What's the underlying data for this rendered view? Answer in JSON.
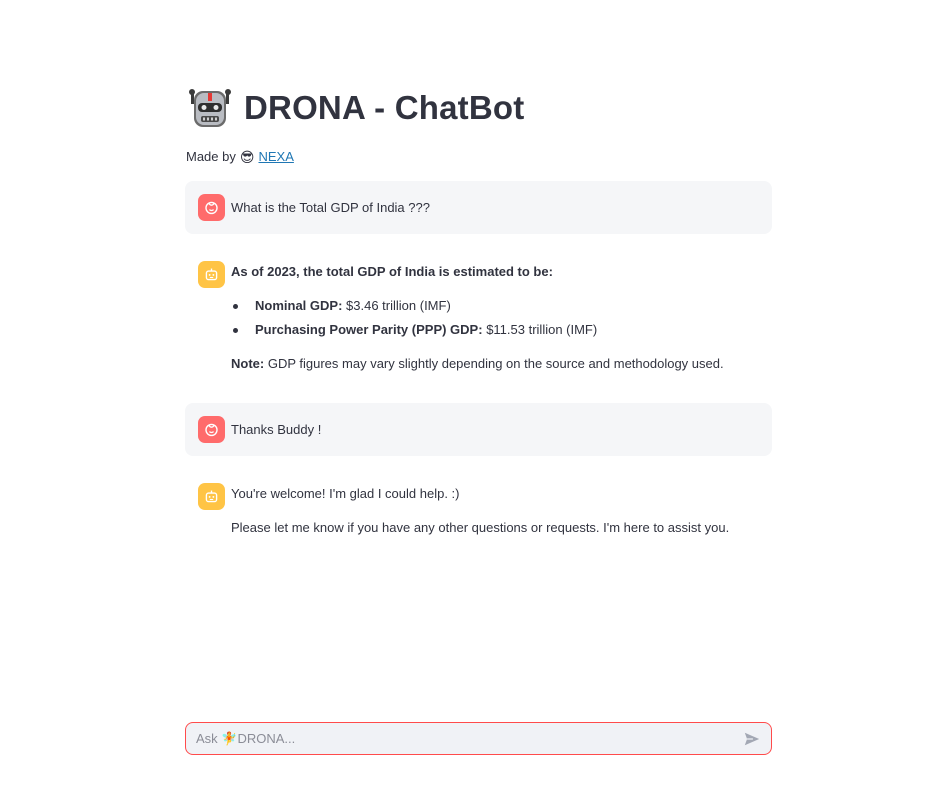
{
  "header": {
    "title": "DRONA - ChatBot",
    "made_by_prefix": "Made by",
    "made_by_emoji": "😎",
    "made_by_link": "NEXA"
  },
  "messages": [
    {
      "role": "user",
      "text": "What is the Total GDP of India ???"
    },
    {
      "role": "assistant",
      "intro": "As of 2023, the total GDP of India is estimated to be:",
      "bullets": [
        {
          "label": "Nominal GDP:",
          "value": "$3.46 trillion (IMF)"
        },
        {
          "label": "Purchasing Power Parity (PPP) GDP:",
          "value": "$11.53 trillion (IMF)"
        }
      ],
      "note_label": "Note:",
      "note_text": "GDP figures may vary slightly depending on the source and methodology used."
    },
    {
      "role": "user",
      "text": "Thanks Buddy !"
    },
    {
      "role": "assistant",
      "line1": "You're welcome! I'm glad I could help. :)",
      "line2": "Please let me know if you have any other questions or requests. I'm here to assist you."
    }
  ],
  "chat_input": {
    "placeholder": "Ask 🧚DRONA..."
  },
  "icons": {
    "user_avatar": "user-face-icon",
    "bot_avatar": "robot-face-icon",
    "send": "send-arrow-icon"
  },
  "colors": {
    "user_avatar": "#ff6b6b",
    "bot_avatar": "#ffc445",
    "input_border": "#ff4b4b",
    "link": "#1f77b4"
  }
}
